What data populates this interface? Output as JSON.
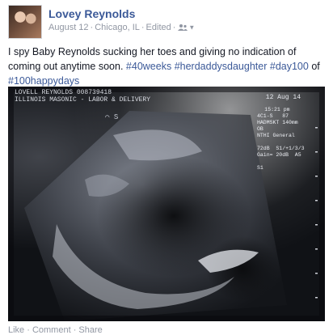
{
  "post": {
    "author": "Lovey Reynolds",
    "date": "August 12",
    "location": "Chicago, IL",
    "edited": "Edited",
    "audience_icon": "friends-icon",
    "text_plain": "I spy Baby Reynolds sucking her toes and giving no indication of coming out anytime soon. ",
    "hashtags": [
      "#40weeks",
      "#herdaddysdaughter",
      "#day100",
      "#100happydays"
    ],
    "text_of": "of",
    "actions": "Like · Comment · Share"
  },
  "ultrasound": {
    "header_line1": "LOVELL REYNOLDS  008739418",
    "header_line2": "ILLINOIS MASONIC - LABOR & DELIVERY",
    "date": "12 Aug 14",
    "time": "15:21 pm",
    "params": "4C1-S   87\nHADMSKT 140mm\nOB\nNTHI General\n\n72dB  S1/+1/3/3\nGain= 20dB  A5\n\nS1",
    "marker": "⌒ S"
  }
}
